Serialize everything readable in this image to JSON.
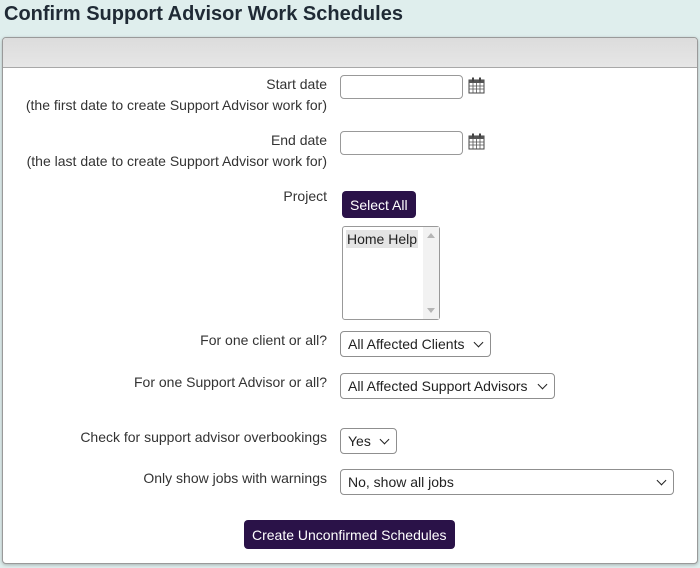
{
  "page": {
    "title": "Confirm Support Advisor Work Schedules"
  },
  "form": {
    "start_date": {
      "label": "Start date",
      "hint": "(the first date to create Support Advisor work for)",
      "value": "",
      "icon": "calendar-icon"
    },
    "end_date": {
      "label": "End date",
      "hint": "(the last date to create Support Advisor work for)",
      "value": "",
      "icon": "calendar-icon"
    },
    "project": {
      "label": "Project",
      "select_all_label": "Select All",
      "options": [
        "Home Help"
      ]
    },
    "client": {
      "label": "For one client or all?",
      "selected": "All Affected Clients"
    },
    "advisor": {
      "label": "For one Support Advisor or all?",
      "selected": "All Affected Support Advisors"
    },
    "overbookings": {
      "label": "Check for support advisor overbookings",
      "selected": "Yes"
    },
    "warnings": {
      "label": "Only show jobs with warnings",
      "selected": "No, show all jobs"
    },
    "submit_label": "Create Unconfirmed Schedules"
  },
  "colors": {
    "button_bg": "#2a1248",
    "page_bg": "#dfeeed"
  }
}
